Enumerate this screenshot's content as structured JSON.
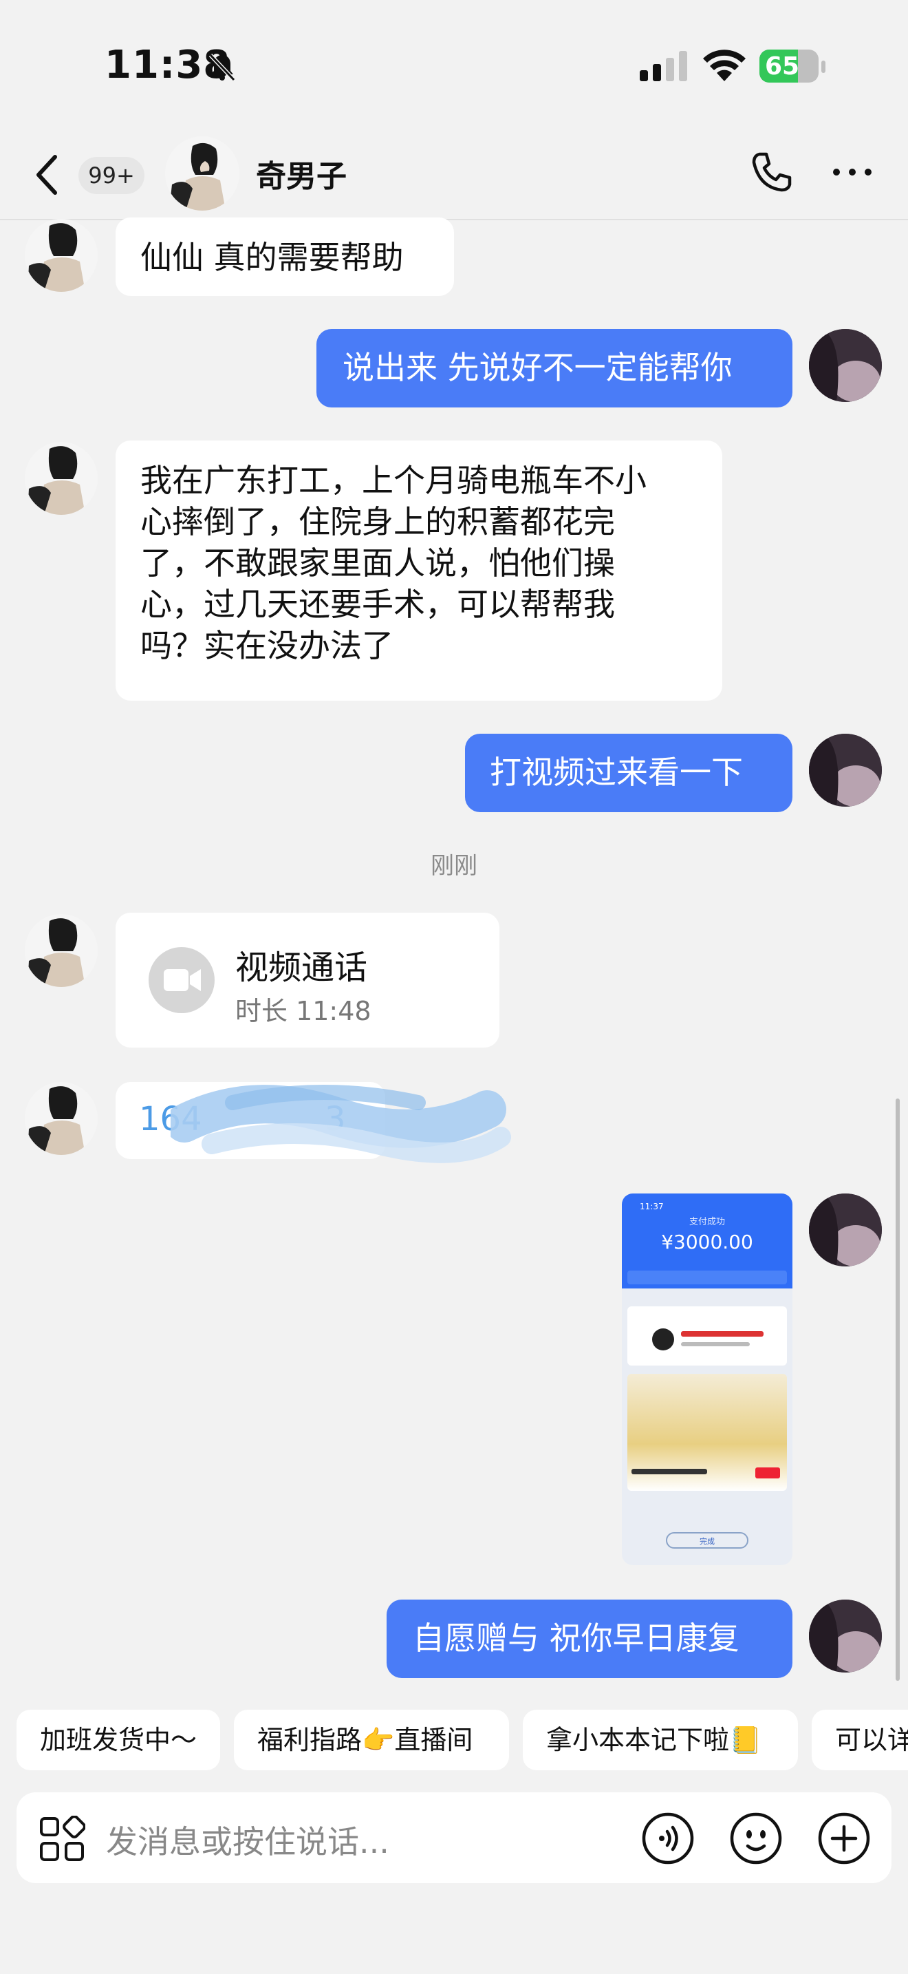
{
  "status_bar": {
    "time": "11:38",
    "battery": "65",
    "battery_level": 0.65
  },
  "header": {
    "unread_badge": "99+",
    "contact_name": "奇男子"
  },
  "messages": [
    {
      "side": "in",
      "text": "仙仙 真的需要帮助"
    },
    {
      "side": "out",
      "text": "说出来 先说好不一定能帮你"
    },
    {
      "side": "in",
      "lines": [
        "我在广东打工，上个月骑电瓶车不小",
        "心摔倒了，住院身上的积蓄都花完",
        "了，不敢跟家里面人说，怕他们操",
        "心，过几天还要手术，可以帮帮我",
        "吗？实在没办法了"
      ]
    },
    {
      "side": "out",
      "text": "打视频过来看一下"
    },
    {
      "side": "out",
      "text": "自愿赠与 祝你早日康复"
    }
  ],
  "timestamp": "刚刚",
  "video_call": {
    "title": "视频通话",
    "duration": "时长 11:48"
  },
  "obscured_number": {
    "visible_prefix": "164",
    "visible_suffix": "3"
  },
  "payment_screenshot": {
    "time": "11:37",
    "status": "支付成功",
    "amount": "¥3000.00",
    "done_button": "完成"
  },
  "quick_replies": [
    "加班发货中～",
    "福利指路👉直播间",
    "拿小本本记下啦📒",
    "可以详"
  ],
  "input": {
    "placeholder": "发消息或按住说话..."
  },
  "colors": {
    "outgoing_bubble": "#4a7cf7",
    "incoming_bubble": "#ffffff",
    "background": "#f2f2f2",
    "battery_green": "#33c759"
  }
}
